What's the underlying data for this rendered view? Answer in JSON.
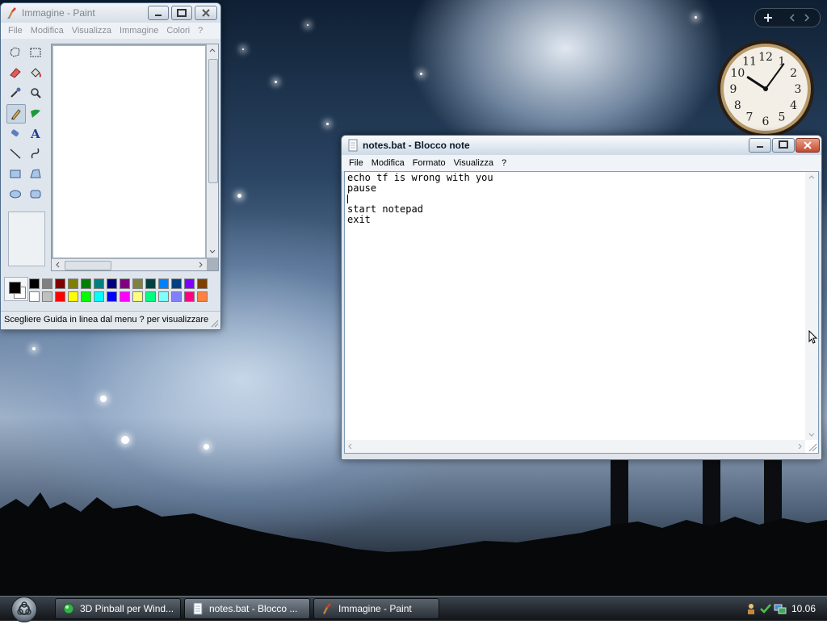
{
  "paint": {
    "title": "Immagine - Paint",
    "menu": [
      "File",
      "Modifica",
      "Visualizza",
      "Immagine",
      "Colori",
      "?"
    ],
    "status_text": "Scegliere Guida in linea dal menu ? per visualizzare",
    "tools": [
      "free-select-icon",
      "rect-select-icon",
      "eraser-icon",
      "fill-bucket-icon",
      "eyedropper-icon",
      "magnifier-icon",
      "pencil-icon",
      "brush-icon",
      "airbrush-icon",
      "text-icon",
      "line-icon",
      "curve-icon",
      "rectangle-icon",
      "polygon-icon",
      "ellipse-icon",
      "rounded-rect-icon"
    ],
    "selected_tool": "pencil-icon",
    "palette_row1": [
      "#000000",
      "#808080",
      "#800000",
      "#808000",
      "#008000",
      "#008080",
      "#000080",
      "#800080",
      "#808040",
      "#004040",
      "#0080ff",
      "#004080",
      "#8000ff",
      "#804000"
    ],
    "palette_row2": [
      "#ffffff",
      "#c0c0c0",
      "#ff0000",
      "#ffff00",
      "#00ff00",
      "#00ffff",
      "#0000ff",
      "#ff00ff",
      "#ffff80",
      "#00ff80",
      "#80ffff",
      "#8080ff",
      "#ff0080",
      "#ff8040"
    ],
    "foreground_color": "#000000",
    "background_color": "#ffffff"
  },
  "notepad": {
    "title": "notes.bat - Blocco note",
    "menu": [
      "File",
      "Modifica",
      "Formato",
      "Visualizza",
      "?"
    ],
    "content": "echo tf is wrong with you\npause\n\nstart notepad\nexit"
  },
  "taskbar": {
    "tasks": [
      {
        "label": "3D Pinball per Wind...",
        "icon": "pinball-icon"
      },
      {
        "label": "notes.bat - Blocco ...",
        "icon": "notepad-icon"
      },
      {
        "label": "Immagine - Paint",
        "icon": "paint-icon"
      }
    ],
    "time": "10.06"
  },
  "clock": {
    "numerals": [
      "12",
      "1",
      "2",
      "3",
      "4",
      "5",
      "6",
      "7",
      "8",
      "9",
      "10",
      "11"
    ],
    "hour": 10,
    "minute": 6
  }
}
